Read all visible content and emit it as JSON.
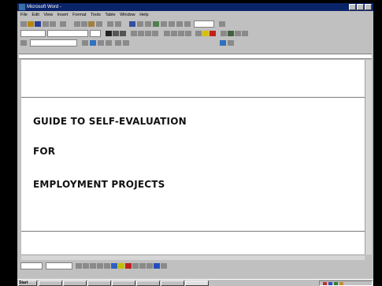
{
  "window": {
    "title": "Microsoft Word - "
  },
  "menu": {
    "items": [
      "File",
      "Edit",
      "View",
      "Insert",
      "Format",
      "Tools",
      "Table",
      "Window",
      "Help"
    ]
  },
  "document": {
    "headings": [
      "GUIDE TO SELF-EVALUATION",
      "FOR",
      "EMPLOYMENT PROJECTS"
    ]
  },
  "taskbar": {
    "start_label": "Start"
  },
  "colors": {
    "title_bar": "#0a246a",
    "chrome": "#c0c0c0",
    "page": "#ffffff"
  }
}
